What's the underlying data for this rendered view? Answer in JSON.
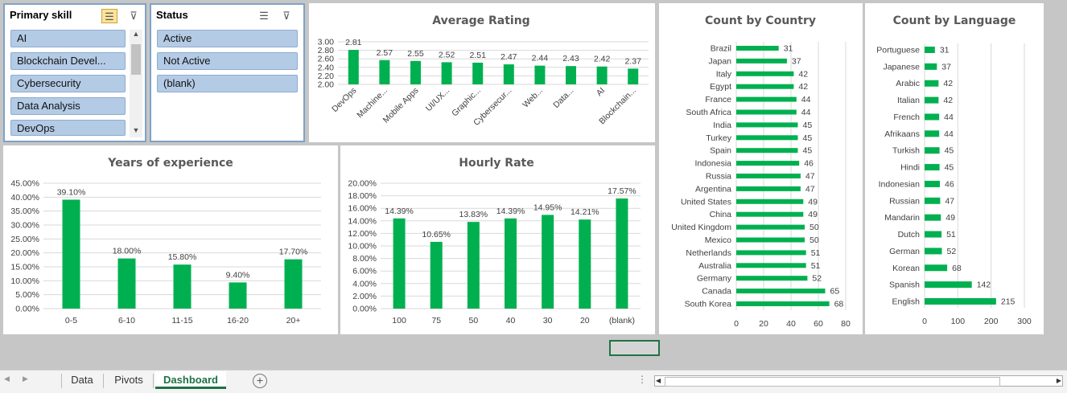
{
  "slicers": {
    "primary_skill": {
      "title": "Primary skill",
      "items": [
        "AI",
        "Blockchain Devel...",
        "Cybersecurity",
        "Data Analysis",
        "DevOps"
      ]
    },
    "status": {
      "title": "Status",
      "items": [
        "Active",
        "Not Active",
        "(blank)"
      ]
    }
  },
  "tabs": [
    "Data",
    "Pivots",
    "Dashboard"
  ],
  "active_tab": "Dashboard",
  "colors": {
    "bar": "#00b050",
    "tab_active": "#1e7145",
    "slicer_item": "#b4cbe6"
  },
  "chart_data": [
    {
      "type": "bar",
      "title": "Average Rating",
      "categories": [
        "DevOps",
        "Machine...",
        "Mobile Apps",
        "UI/UX...",
        "Graphic...",
        "Cybersecur...",
        "Web...",
        "Data...",
        "AI",
        "Blockchain..."
      ],
      "values": [
        2.81,
        2.57,
        2.55,
        2.52,
        2.51,
        2.47,
        2.44,
        2.43,
        2.42,
        2.37
      ],
      "labels": [
        "2.81",
        "2.57",
        "2.55",
        "2.52",
        "2.51",
        "2.47",
        "2.44",
        "2.43",
        "2.42",
        "2.37"
      ],
      "yticks": [
        "3.00",
        "2.80",
        "2.60",
        "2.40",
        "2.20",
        "2.00"
      ],
      "ylim": [
        2.0,
        3.0
      ]
    },
    {
      "type": "bar",
      "orientation": "horizontal",
      "title": "Count by Country",
      "categories": [
        "Brazil",
        "Japan",
        "Italy",
        "Egypt",
        "France",
        "South Africa",
        "India",
        "Turkey",
        "Spain",
        "Indonesia",
        "Russia",
        "Argentina",
        "United States",
        "China",
        "United Kingdom",
        "Mexico",
        "Netherlands",
        "Australia",
        "Germany",
        "Canada",
        "South Korea"
      ],
      "values": [
        31,
        37,
        42,
        42,
        44,
        44,
        45,
        45,
        45,
        46,
        47,
        47,
        49,
        49,
        50,
        50,
        51,
        51,
        52,
        65,
        68
      ],
      "xticks": [
        "0",
        "20",
        "40",
        "60",
        "80"
      ],
      "xlim": [
        0,
        80
      ]
    },
    {
      "type": "bar",
      "orientation": "horizontal",
      "title": "Count by Language",
      "categories": [
        "Portuguese",
        "Japanese",
        "Arabic",
        "Italian",
        "French",
        "Afrikaans",
        "Turkish",
        "Hindi",
        "Indonesian",
        "Russian",
        "Mandarin",
        "Dutch",
        "German",
        "Korean",
        "Spanish",
        "English"
      ],
      "values": [
        31,
        37,
        42,
        42,
        44,
        44,
        45,
        45,
        46,
        47,
        49,
        51,
        52,
        68,
        142,
        215
      ],
      "xticks": [
        "0",
        "100",
        "200",
        "300"
      ],
      "xlim": [
        0,
        300
      ]
    },
    {
      "type": "bar",
      "title": "Years of experience",
      "categories": [
        "0-5",
        "6-10",
        "11-15",
        "16-20",
        "20+"
      ],
      "values": [
        39.1,
        18.0,
        15.8,
        9.4,
        17.7
      ],
      "labels": [
        "39.10%",
        "18.00%",
        "15.80%",
        "9.40%",
        "17.70%"
      ],
      "yticks": [
        "45.00%",
        "40.00%",
        "35.00%",
        "30.00%",
        "25.00%",
        "20.00%",
        "15.00%",
        "10.00%",
        "5.00%",
        "0.00%"
      ],
      "ylim": [
        0,
        45
      ]
    },
    {
      "type": "bar",
      "title": "Hourly Rate",
      "categories": [
        "100",
        "75",
        "50",
        "40",
        "30",
        "20",
        "(blank)"
      ],
      "values": [
        14.39,
        10.65,
        13.83,
        14.39,
        14.95,
        14.21,
        17.57
      ],
      "labels": [
        "14.39%",
        "10.65%",
        "13.83%",
        "14.39%",
        "14.95%",
        "14.21%",
        "17.57%"
      ],
      "yticks": [
        "20.00%",
        "18.00%",
        "16.00%",
        "14.00%",
        "12.00%",
        "10.00%",
        "8.00%",
        "6.00%",
        "4.00%",
        "2.00%",
        "0.00%"
      ],
      "ylim": [
        0,
        20
      ]
    }
  ]
}
